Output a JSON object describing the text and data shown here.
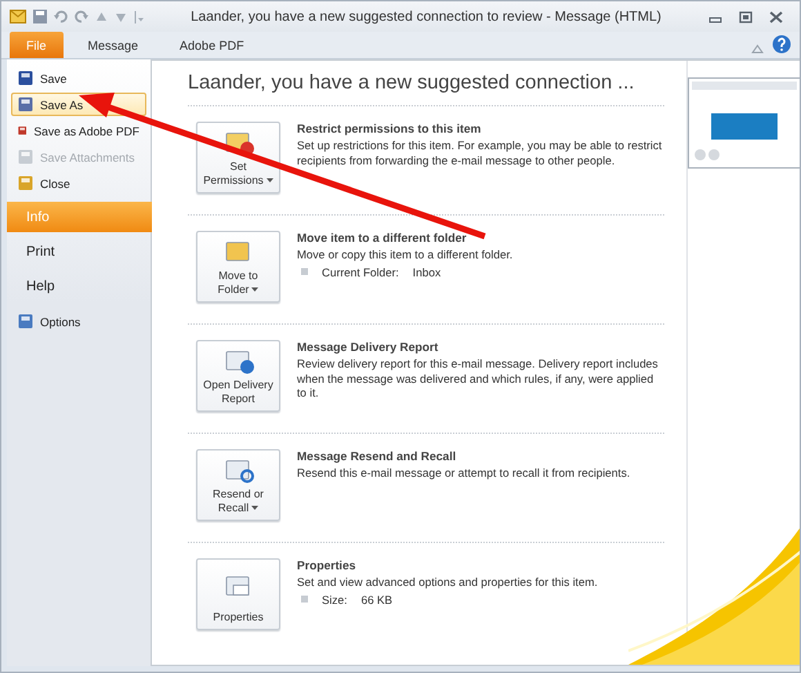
{
  "window": {
    "title": "Laander, you have a new suggested connection to review  -  Message (HTML)"
  },
  "ribbon_tabs": [
    {
      "label": "File",
      "selected": true
    },
    {
      "label": "Message",
      "selected": false
    },
    {
      "label": "Adobe PDF",
      "selected": false
    }
  ],
  "backstage_menu": [
    {
      "label": "Save",
      "kind": "command",
      "selected": false,
      "disabled": false
    },
    {
      "label": "Save As",
      "kind": "command",
      "selected": true,
      "disabled": false
    },
    {
      "label": "Save as Adobe PDF",
      "kind": "command",
      "selected": false,
      "disabled": false
    },
    {
      "label": "Save Attachments",
      "kind": "command",
      "selected": false,
      "disabled": true
    },
    {
      "label": "Close",
      "kind": "command",
      "selected": false,
      "disabled": false
    },
    {
      "label": "Info",
      "kind": "tab",
      "selected": true
    },
    {
      "label": "Print",
      "kind": "tab",
      "selected": false
    },
    {
      "label": "Help",
      "kind": "tab",
      "selected": false
    },
    {
      "label": "Options",
      "kind": "command",
      "selected": false,
      "disabled": false
    }
  ],
  "heading": "Laander, you have a new suggested connection ...",
  "sections": [
    {
      "button_lines": [
        "Set",
        "Permissions"
      ],
      "dropdown": true,
      "title": "Restrict permissions to this item",
      "description": "Set up restrictions for this item. For example, you may be able to restrict recipients from forwarding the e-mail message to other people."
    },
    {
      "button_lines": [
        "Move to",
        "Folder"
      ],
      "dropdown": true,
      "title": "Move item to a different folder",
      "description": "Move or copy this item to a different folder.",
      "detail": {
        "label": "Current Folder:",
        "value": "Inbox"
      }
    },
    {
      "button_lines": [
        "Open Delivery",
        "Report"
      ],
      "dropdown": false,
      "title": "Message Delivery Report",
      "description": "Review delivery report for this e-mail message. Delivery report includes when the message was delivered and which rules, if any, were applied to it."
    },
    {
      "button_lines": [
        "Resend or",
        "Recall"
      ],
      "dropdown": true,
      "title": "Message Resend and Recall",
      "description": "Resend this e-mail message or attempt to recall it from recipients."
    },
    {
      "button_lines": [
        "Properties"
      ],
      "dropdown": false,
      "title": "Properties",
      "description": "Set and view advanced options and properties for this item.",
      "detail": {
        "label": "Size:",
        "value": "66 KB"
      }
    }
  ]
}
